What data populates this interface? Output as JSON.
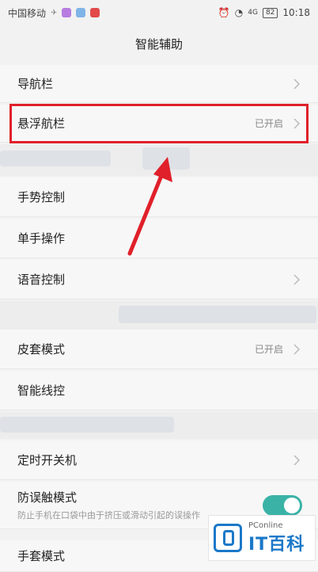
{
  "status_bar": {
    "carrier": "中国移动",
    "network": "4G",
    "battery": "82",
    "time": "10:18"
  },
  "header": {
    "title": "智能辅助"
  },
  "items": [
    {
      "label": "导航栏",
      "status": ""
    },
    {
      "label": "悬浮航栏",
      "status": "已开启"
    },
    {
      "label": "手势控制",
      "status": ""
    },
    {
      "label": "单手操作",
      "status": ""
    },
    {
      "label": "语音控制",
      "status": ""
    },
    {
      "label": "皮套模式",
      "status": "已开启"
    },
    {
      "label": "智能线控",
      "status": ""
    },
    {
      "label": "定时开关机",
      "status": ""
    },
    {
      "label": "防误触模式",
      "sub": "防止手机在口袋中由于挤压或滑动引起的误操作",
      "toggle": true
    },
    {
      "label": "手套模式",
      "status": ""
    }
  ],
  "watermark": {
    "top": "PConline",
    "main": "IT百科"
  },
  "colors": {
    "highlight": "#e0202a",
    "toggle_on": "#3ab3a6",
    "brand": "#1a78c8"
  }
}
